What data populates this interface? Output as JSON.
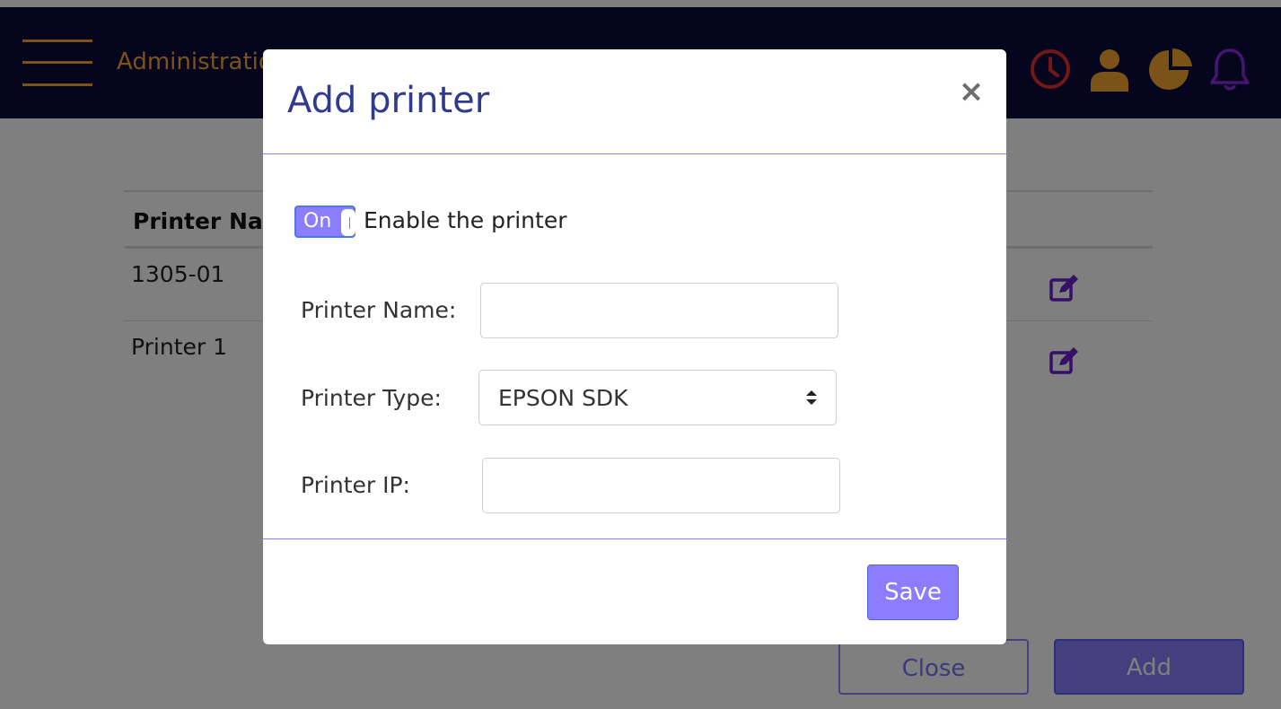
{
  "navbar": {
    "title": "Administration",
    "icons": [
      "menu-icon",
      "clock-icon",
      "user-icon",
      "pie-chart-icon",
      "bell-icon"
    ],
    "colors": {
      "background": "#0c0b3c",
      "accent": "#f7a631",
      "clock": "#e4312c",
      "bell": "#8a2be2"
    }
  },
  "table": {
    "headers": [
      "Printer Name"
    ],
    "rows": [
      {
        "name": "1305-01"
      },
      {
        "name": "Printer 1"
      }
    ]
  },
  "page_footer": {
    "close_label": "Close",
    "add_label": "Add"
  },
  "modal": {
    "title": "Add printer",
    "close_symbol": "×",
    "toggle": {
      "label": "On",
      "checked": true
    },
    "enable_label": "Enable the printer",
    "fields": {
      "name_label": "Printer Name:",
      "name_value": "",
      "type_label": "Printer Type:",
      "type_value": "EPSON SDK",
      "ip_label": "Printer IP:",
      "ip_value": ""
    },
    "save_label": "Save",
    "colors": {
      "title": "#2f3a90",
      "primary": "#8a7dff"
    }
  }
}
